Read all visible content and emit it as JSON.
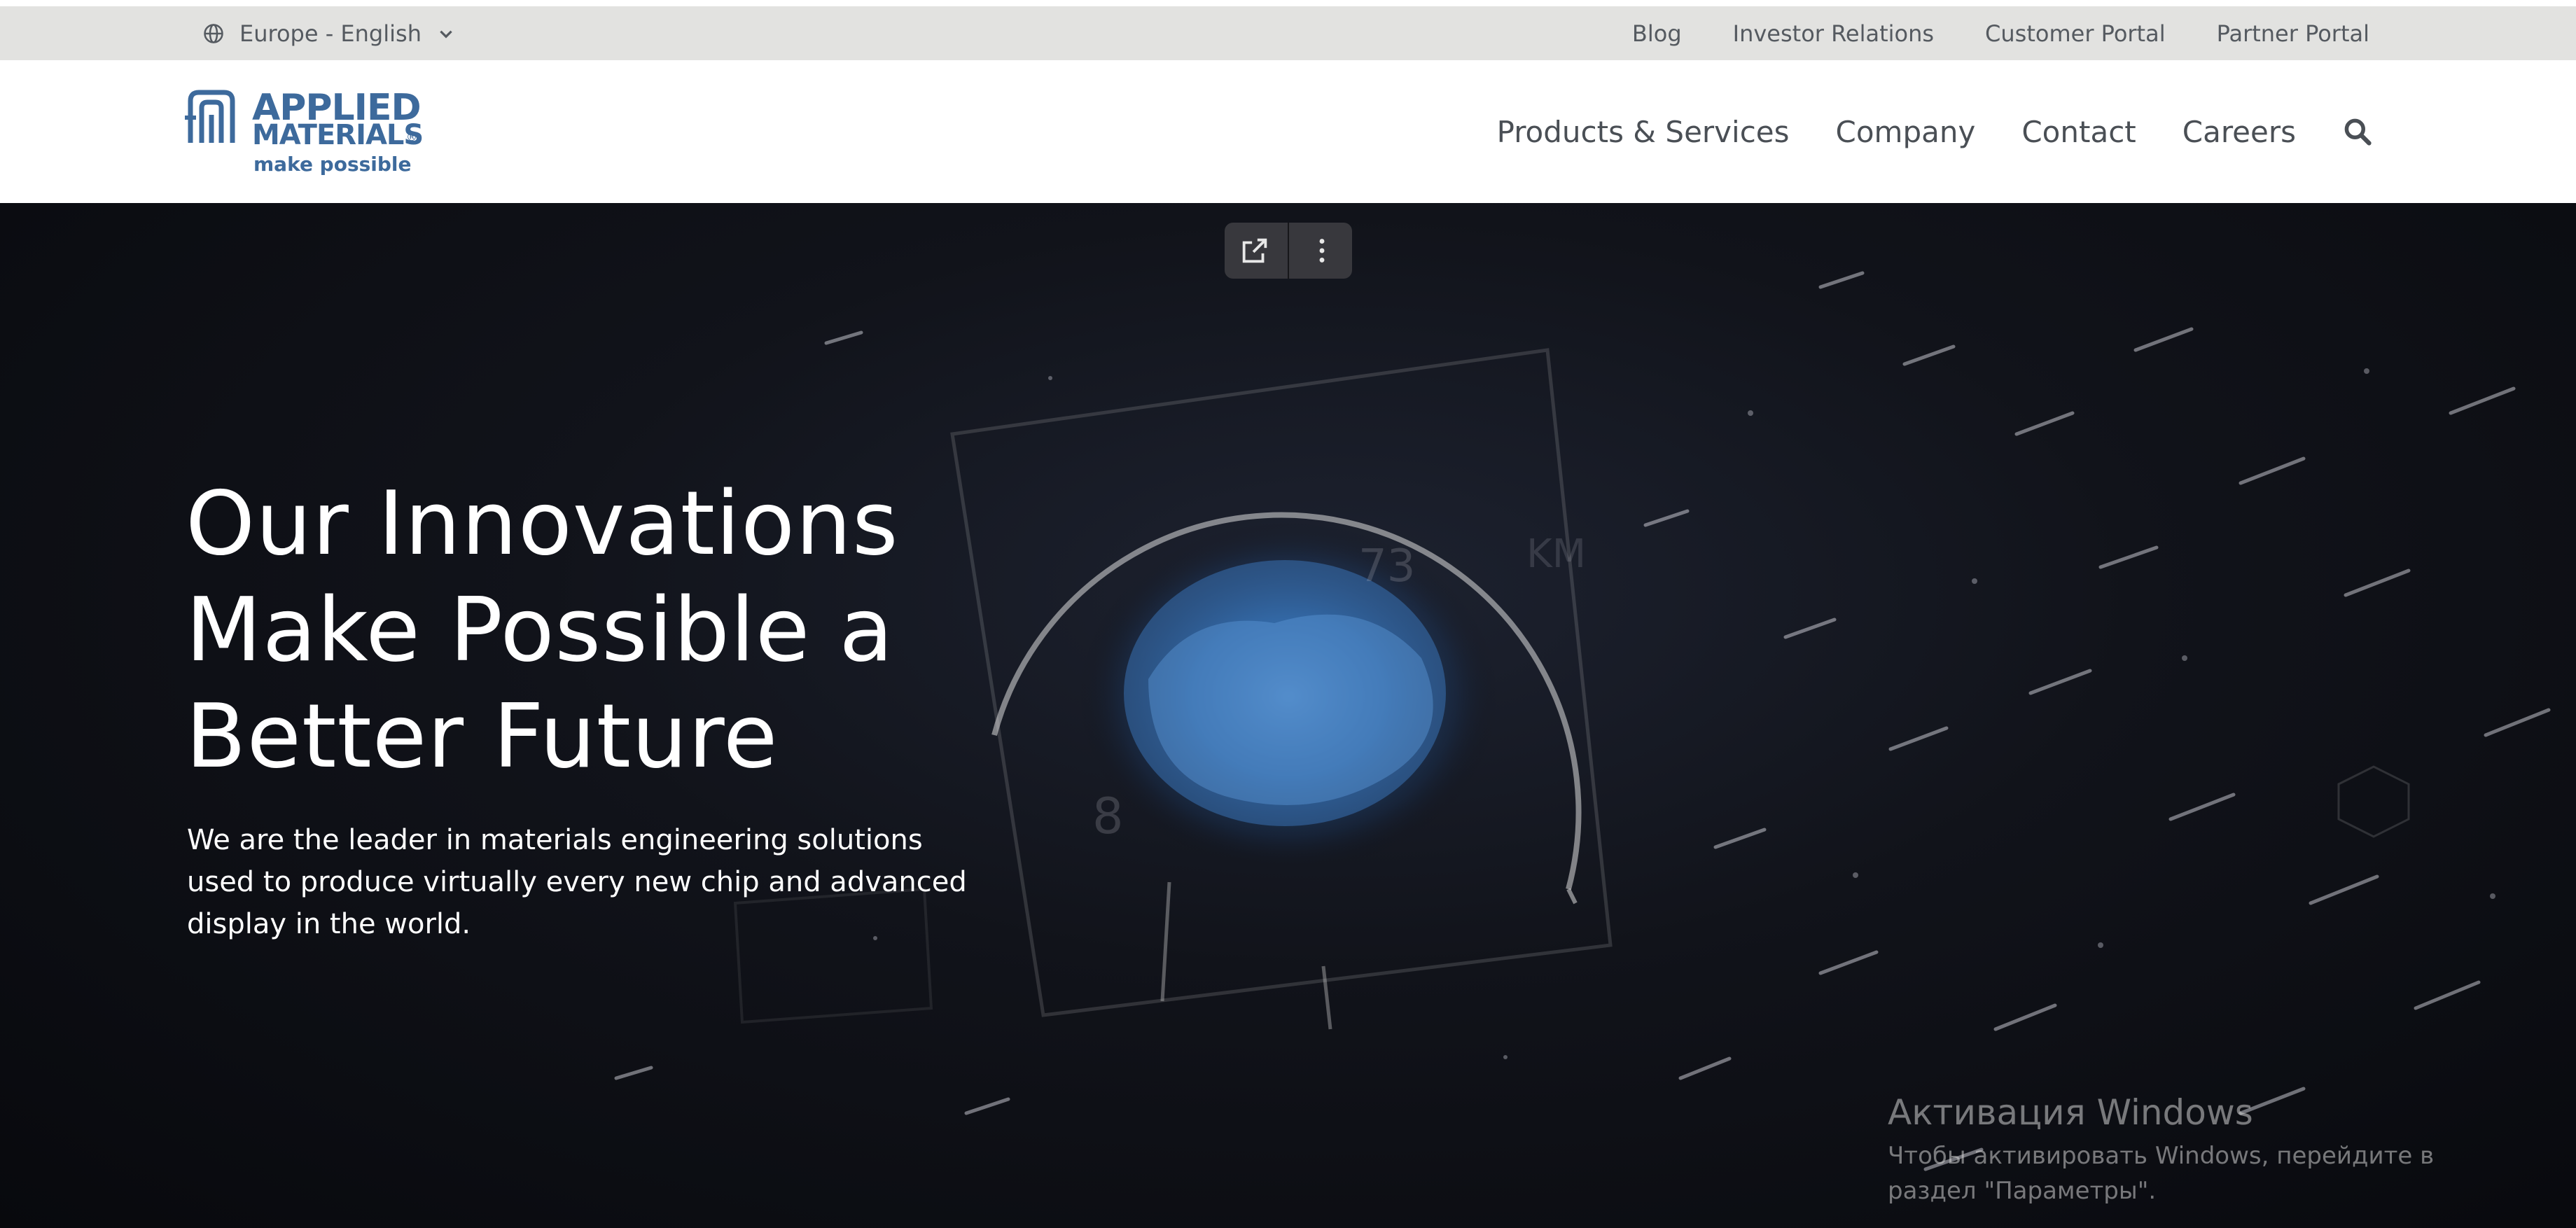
{
  "utility_bar": {
    "region": "Europe - English",
    "links": [
      "Blog",
      "Investor Relations",
      "Customer Portal",
      "Partner Portal"
    ]
  },
  "header": {
    "logo": {
      "line1": "APPLIED",
      "line2": "MATERIALS",
      "registered": "®",
      "tagline": "make possible"
    },
    "nav": [
      "Products & Services",
      "Company",
      "Contact",
      "Careers"
    ],
    "search_icon": "search-icon"
  },
  "video_controls": {
    "icons": [
      "external-link-icon",
      "more-vertical-icon"
    ]
  },
  "hero": {
    "title": "Our Innovations Make Possible a Better Future",
    "description": "We are the leader in materials engineering solutions used to produce virtually every new chip and advanced display in the world."
  },
  "windows_watermark": {
    "title": "Активация Windows",
    "subtitle": "Чтобы активировать Windows, перейдите в раздел \"Параметры\"."
  },
  "colors": {
    "utility_bar_bg": "#e2e2e0",
    "brand_blue": "#3d6a9c",
    "nav_text": "#4a4f55",
    "hero_bg": "#0c0d12"
  }
}
